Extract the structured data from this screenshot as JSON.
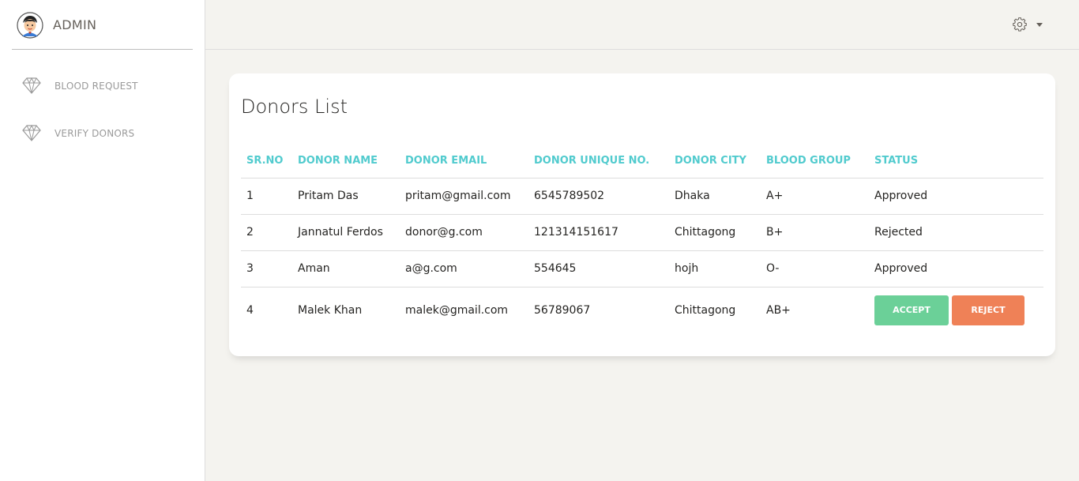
{
  "brand": {
    "title": "ADMIN"
  },
  "sidebar": {
    "items": [
      {
        "label": "BLOOD REQUEST",
        "icon": "diamond-icon"
      },
      {
        "label": "VERIFY DONORS",
        "icon": "diamond-icon"
      }
    ]
  },
  "topbar": {
    "settings_icon": "gear-icon"
  },
  "card": {
    "title": "Donors List",
    "columns": [
      "SR.NO",
      "DONOR NAME",
      "DONOR EMAIL",
      "DONOR UNIQUE NO.",
      "DONOR CITY",
      "BLOOD GROUP",
      "STATUS"
    ],
    "rows": [
      {
        "sr": "1",
        "name": "Pritam Das",
        "email": "pritam@gmail.com",
        "unique": "6545789502",
        "city": "Dhaka",
        "blood": "A+",
        "status": "Approved"
      },
      {
        "sr": "2",
        "name": "Jannatul Ferdos",
        "email": "donor@g.com",
        "unique": "121314151617",
        "city": "Chittagong",
        "blood": "B+",
        "status": "Rejected"
      },
      {
        "sr": "3",
        "name": "Aman",
        "email": "a@g.com",
        "unique": "554645",
        "city": "hojh",
        "blood": "O-",
        "status": "Approved"
      },
      {
        "sr": "4",
        "name": "Malek Khan",
        "email": "malek@gmail.com",
        "unique": "56789067",
        "city": "Chittagong",
        "blood": "AB+",
        "status": ""
      }
    ],
    "actions": {
      "accept_label": "ACCEPT",
      "reject_label": "REJECT"
    }
  },
  "colors": {
    "header_accent": "#51cbce",
    "accept": "#6bd098",
    "reject": "#ef8157",
    "page_bg": "#f4f3ef"
  }
}
